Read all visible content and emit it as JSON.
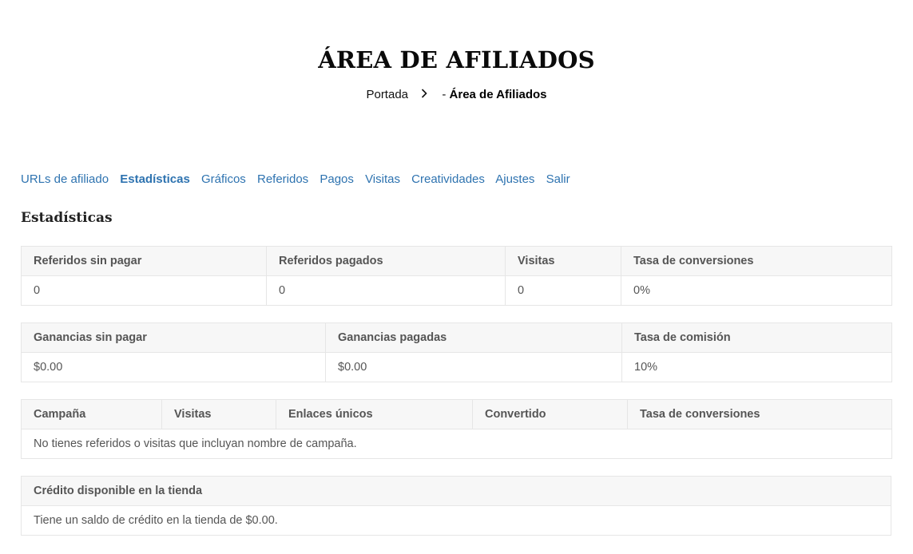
{
  "header": {
    "title": "ÁREA DE AFILIADOS",
    "breadcrumb": {
      "home": "Portada",
      "separator_icon": "chevron-right-icon",
      "current_prefix": "- ",
      "current": "Área de Afiliados"
    }
  },
  "tabs": [
    {
      "label": "URLs de afiliado",
      "active": false
    },
    {
      "label": "Estadísticas",
      "active": true
    },
    {
      "label": "Gráficos",
      "active": false
    },
    {
      "label": "Referidos",
      "active": false
    },
    {
      "label": "Pagos",
      "active": false
    },
    {
      "label": "Visitas",
      "active": false
    },
    {
      "label": "Creatividades",
      "active": false
    },
    {
      "label": "Ajustes",
      "active": false
    },
    {
      "label": "Salir",
      "active": false
    }
  ],
  "section_title": "Estadísticas",
  "referrals_table": {
    "headers": [
      "Referidos sin pagar",
      "Referidos pagados",
      "Visitas",
      "Tasa de conversiones"
    ],
    "row": [
      "0",
      "0",
      "0",
      "0%"
    ]
  },
  "earnings_table": {
    "headers": [
      "Ganancias sin pagar",
      "Ganancias pagadas",
      "Tasa de comisión"
    ],
    "row": [
      "$0.00",
      "$0.00",
      "10%"
    ]
  },
  "campaign_table": {
    "headers": [
      "Campaña",
      "Visitas",
      "Enlaces únicos",
      "Convertido",
      "Tasa de conversiones"
    ],
    "empty_message": "No tienes referidos o visitas que incluyan nombre de campaña."
  },
  "store_credit_table": {
    "header": "Crédito disponible en la tienda",
    "message": "Tiene un saldo de crédito en la tienda de $0.00."
  },
  "colors": {
    "link": "#2e73b0",
    "header_bg": "#f7f7f7",
    "border": "#e6e6e6"
  }
}
